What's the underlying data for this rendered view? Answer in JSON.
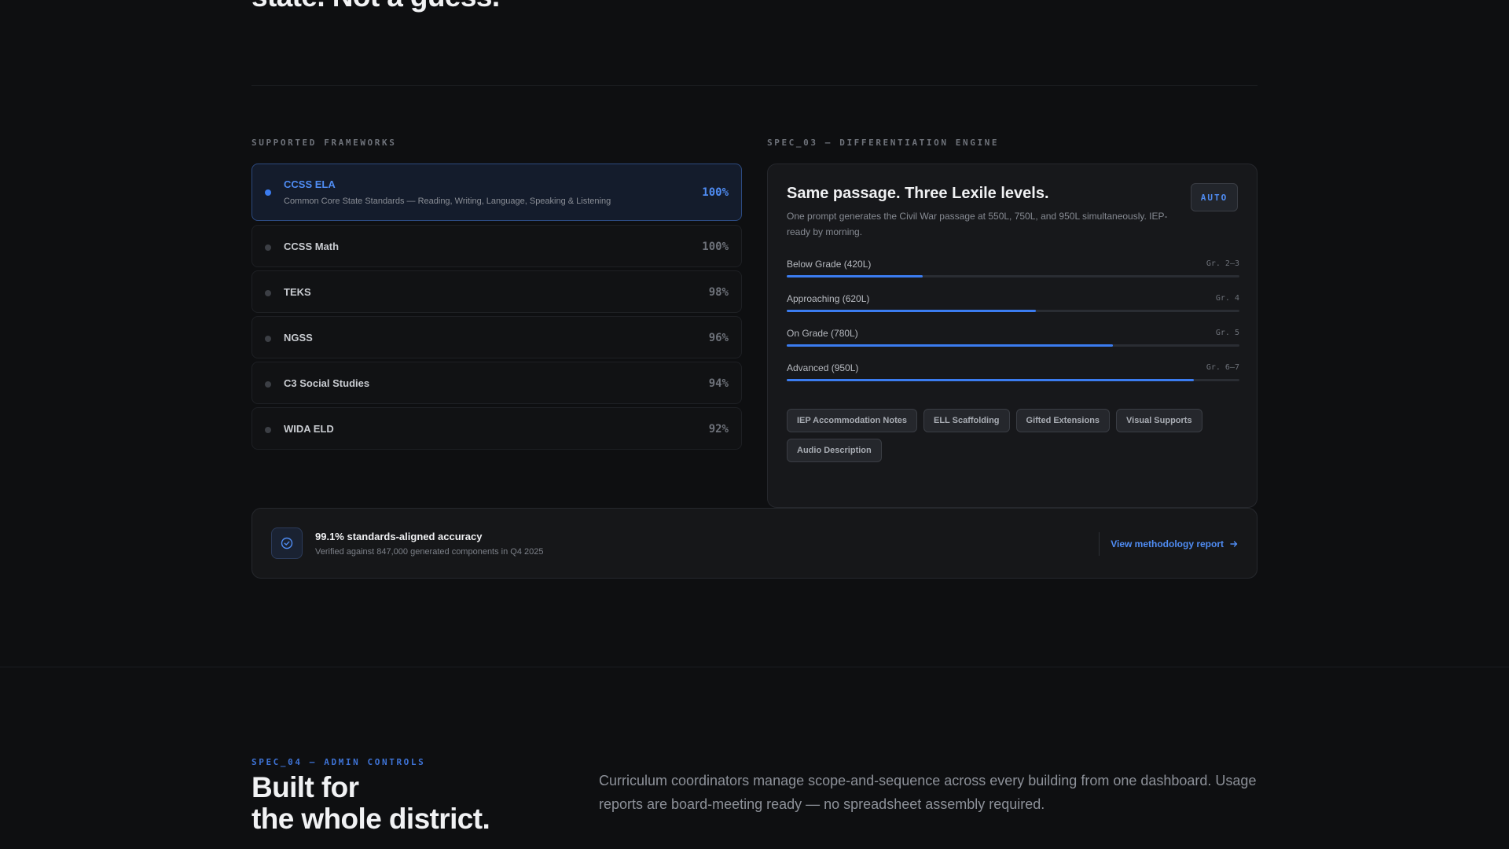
{
  "hero": {
    "line1": "",
    "line2": "state. Not a guess."
  },
  "frameworks": {
    "eyebrow": "SUPPORTED FRAMEWORKS",
    "items": [
      {
        "name": "CCSS ELA",
        "desc": "Common Core State Standards — Reading, Writing, Language, Speaking & Listening",
        "pct": "100%",
        "active": true
      },
      {
        "name": "CCSS Math",
        "desc": "",
        "pct": "100%"
      },
      {
        "name": "TEKS",
        "desc": "",
        "pct": "98%"
      },
      {
        "name": "NGSS",
        "desc": "",
        "pct": "96%"
      },
      {
        "name": "C3 Social Studies",
        "desc": "",
        "pct": "94%"
      },
      {
        "name": "WIDA ELD",
        "desc": "",
        "pct": "92%"
      }
    ]
  },
  "differentiation": {
    "eyebrow": "SPEC_03 — DIFFERENTIATION ENGINE",
    "title": "Same passage. Three Lexile levels.",
    "subtitle": "One prompt generates the Civil War passage at 550L, 750L, and 950L simultaneously. IEP-ready by morning.",
    "badge": "AUTO",
    "levels": [
      {
        "label": "Below Grade (420L)",
        "grade": "Gr. 2–3",
        "fill": 0.3
      },
      {
        "label": "Approaching (620L)",
        "grade": "Gr. 4",
        "fill": 0.55
      },
      {
        "label": "On Grade (780L)",
        "grade": "Gr. 5",
        "fill": 0.72
      },
      {
        "label": "Advanced (950L)",
        "grade": "Gr. 6–7",
        "fill": 0.9
      }
    ],
    "tags": [
      "IEP Accommodation Notes",
      "ELL Scaffolding",
      "Gifted Extensions",
      "Visual Supports",
      "Audio Description"
    ]
  },
  "accuracy": {
    "title": "99.1% standards-aligned accuracy",
    "subtitle": "Verified against 847,000 generated components in Q4 2025",
    "link": "View methodology report",
    "icon": "check-circle-icon"
  },
  "admin": {
    "eyebrow": "SPEC_04 — ADMIN CONTROLS",
    "title_line1": "Built for",
    "title_line2": "the whole district.",
    "desc": "Curriculum coordinators manage scope-and-sequence across every building from one dashboard. Usage reports are board-meeting ready — no spreadsheet assembly required."
  },
  "colors": {
    "accent": "#3b7cf0",
    "background": "#0e0f11"
  }
}
